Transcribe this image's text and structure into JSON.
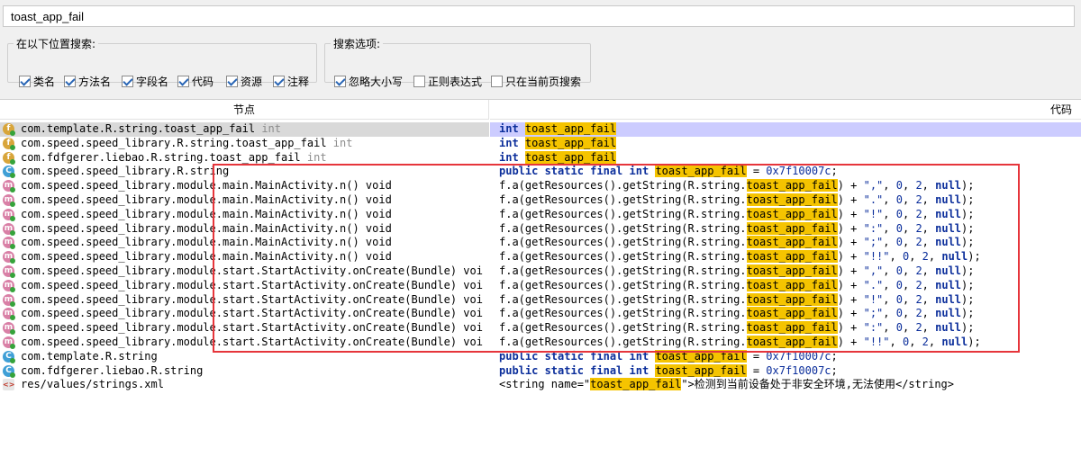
{
  "search": {
    "value": "toast_app_fail"
  },
  "search_in": {
    "legend": "在以下位置搜索:",
    "options": [
      {
        "label": "类名",
        "checked": true
      },
      {
        "label": "方法名",
        "checked": true
      },
      {
        "label": "字段名",
        "checked": true
      },
      {
        "label": "代码",
        "checked": true
      },
      {
        "label": "资源",
        "checked": true
      },
      {
        "label": "注释",
        "checked": true
      }
    ]
  },
  "search_options": {
    "legend": "搜索选项:",
    "options": [
      {
        "label": "忽略大小写",
        "checked": true
      },
      {
        "label": "正则表达式",
        "checked": false
      },
      {
        "label": "只在当前页搜索",
        "checked": false
      }
    ]
  },
  "columns": {
    "node": "节点",
    "code": "代码"
  },
  "colors": {
    "highlight": "#f5c400",
    "selected_row": "#ccccff",
    "red_box": "#e6353b",
    "keyword": "#0b2e9b"
  },
  "results": [
    {
      "icon": "field-icon",
      "node": "com.template.R.string.toast_app_fail",
      "sub": "int",
      "code": [
        [
          "kw",
          "int"
        ],
        [
          "t",
          " "
        ],
        [
          "hl",
          "toast_app_fail"
        ]
      ],
      "selected": true
    },
    {
      "icon": "field-icon",
      "node": "com.speed.speed_library.R.string.toast_app_fail",
      "sub": "int",
      "code": [
        [
          "kw",
          "int"
        ],
        [
          "t",
          " "
        ],
        [
          "hl",
          "toast_app_fail"
        ]
      ]
    },
    {
      "icon": "field-icon",
      "node": "com.fdfgerer.liebao.R.string.toast_app_fail",
      "sub": "int",
      "code": [
        [
          "kw",
          "int"
        ],
        [
          "t",
          " "
        ],
        [
          "hl",
          "toast_app_fail"
        ]
      ]
    },
    {
      "icon": "class-icon",
      "node": "com.speed.speed_library.R.string",
      "sub": "",
      "code": [
        [
          "kw",
          "public static final"
        ],
        [
          "t",
          " "
        ],
        [
          "kw",
          "int"
        ],
        [
          "t",
          " "
        ],
        [
          "hl",
          "toast_app_fail"
        ],
        [
          "t",
          " = "
        ],
        [
          "num",
          "0x7f10007c"
        ],
        [
          "t",
          ";"
        ]
      ]
    },
    {
      "icon": "method-icon",
      "node": "com.speed.speed_library.module.main.MainActivity.n() void",
      "sub": "",
      "code": [
        [
          "t",
          "f.a(getResources().getString(R.string."
        ],
        [
          "hl",
          "toast_app_fail"
        ],
        [
          "t",
          ") + "
        ],
        [
          "str",
          "\",\""
        ],
        [
          "t",
          ", "
        ],
        [
          "num",
          "0"
        ],
        [
          "t",
          ", "
        ],
        [
          "num",
          "2"
        ],
        [
          "t",
          ", "
        ],
        [
          "kw",
          "null"
        ],
        [
          "t",
          ");"
        ]
      ]
    },
    {
      "icon": "method-icon",
      "node": "com.speed.speed_library.module.main.MainActivity.n() void",
      "sub": "",
      "code": [
        [
          "t",
          "f.a(getResources().getString(R.string."
        ],
        [
          "hl",
          "toast_app_fail"
        ],
        [
          "t",
          ") + "
        ],
        [
          "str",
          "\".\""
        ],
        [
          "t",
          ", "
        ],
        [
          "num",
          "0"
        ],
        [
          "t",
          ", "
        ],
        [
          "num",
          "2"
        ],
        [
          "t",
          ", "
        ],
        [
          "kw",
          "null"
        ],
        [
          "t",
          ");"
        ]
      ]
    },
    {
      "icon": "method-icon",
      "node": "com.speed.speed_library.module.main.MainActivity.n() void",
      "sub": "",
      "code": [
        [
          "t",
          "f.a(getResources().getString(R.string."
        ],
        [
          "hl",
          "toast_app_fail"
        ],
        [
          "t",
          ") + "
        ],
        [
          "str",
          "\"!\""
        ],
        [
          "t",
          ", "
        ],
        [
          "num",
          "0"
        ],
        [
          "t",
          ", "
        ],
        [
          "num",
          "2"
        ],
        [
          "t",
          ", "
        ],
        [
          "kw",
          "null"
        ],
        [
          "t",
          ");"
        ]
      ]
    },
    {
      "icon": "method-icon",
      "node": "com.speed.speed_library.module.main.MainActivity.n() void",
      "sub": "",
      "code": [
        [
          "t",
          "f.a(getResources().getString(R.string."
        ],
        [
          "hl",
          "toast_app_fail"
        ],
        [
          "t",
          ") + "
        ],
        [
          "str",
          "\":\""
        ],
        [
          "t",
          ", "
        ],
        [
          "num",
          "0"
        ],
        [
          "t",
          ", "
        ],
        [
          "num",
          "2"
        ],
        [
          "t",
          ", "
        ],
        [
          "kw",
          "null"
        ],
        [
          "t",
          ");"
        ]
      ]
    },
    {
      "icon": "method-icon",
      "node": "com.speed.speed_library.module.main.MainActivity.n() void",
      "sub": "",
      "code": [
        [
          "t",
          "f.a(getResources().getString(R.string."
        ],
        [
          "hl",
          "toast_app_fail"
        ],
        [
          "t",
          ") + "
        ],
        [
          "str",
          "\";\""
        ],
        [
          "t",
          ", "
        ],
        [
          "num",
          "0"
        ],
        [
          "t",
          ", "
        ],
        [
          "num",
          "2"
        ],
        [
          "t",
          ", "
        ],
        [
          "kw",
          "null"
        ],
        [
          "t",
          ");"
        ]
      ]
    },
    {
      "icon": "method-icon",
      "node": "com.speed.speed_library.module.main.MainActivity.n() void",
      "sub": "",
      "code": [
        [
          "t",
          "f.a(getResources().getString(R.string."
        ],
        [
          "hl",
          "toast_app_fail"
        ],
        [
          "t",
          ") + "
        ],
        [
          "str",
          "\"!!\""
        ],
        [
          "t",
          ", "
        ],
        [
          "num",
          "0"
        ],
        [
          "t",
          ", "
        ],
        [
          "num",
          "2"
        ],
        [
          "t",
          ", "
        ],
        [
          "kw",
          "null"
        ],
        [
          "t",
          ");"
        ]
      ]
    },
    {
      "icon": "method-icon",
      "node": "com.speed.speed_library.module.start.StartActivity.onCreate(Bundle) voi",
      "sub": "",
      "code": [
        [
          "t",
          "f.a(getResources().getString(R.string."
        ],
        [
          "hl",
          "toast_app_fail"
        ],
        [
          "t",
          ") + "
        ],
        [
          "str",
          "\",\""
        ],
        [
          "t",
          ", "
        ],
        [
          "num",
          "0"
        ],
        [
          "t",
          ", "
        ],
        [
          "num",
          "2"
        ],
        [
          "t",
          ", "
        ],
        [
          "kw",
          "null"
        ],
        [
          "t",
          ");"
        ]
      ]
    },
    {
      "icon": "method-icon",
      "node": "com.speed.speed_library.module.start.StartActivity.onCreate(Bundle) voi",
      "sub": "",
      "code": [
        [
          "t",
          "f.a(getResources().getString(R.string."
        ],
        [
          "hl",
          "toast_app_fail"
        ],
        [
          "t",
          ") + "
        ],
        [
          "str",
          "\".\""
        ],
        [
          "t",
          ", "
        ],
        [
          "num",
          "0"
        ],
        [
          "t",
          ", "
        ],
        [
          "num",
          "2"
        ],
        [
          "t",
          ", "
        ],
        [
          "kw",
          "null"
        ],
        [
          "t",
          ");"
        ]
      ]
    },
    {
      "icon": "method-icon",
      "node": "com.speed.speed_library.module.start.StartActivity.onCreate(Bundle) voi",
      "sub": "",
      "code": [
        [
          "t",
          "f.a(getResources().getString(R.string."
        ],
        [
          "hl",
          "toast_app_fail"
        ],
        [
          "t",
          ") + "
        ],
        [
          "str",
          "\"!\""
        ],
        [
          "t",
          ", "
        ],
        [
          "num",
          "0"
        ],
        [
          "t",
          ", "
        ],
        [
          "num",
          "2"
        ],
        [
          "t",
          ", "
        ],
        [
          "kw",
          "null"
        ],
        [
          "t",
          ");"
        ]
      ]
    },
    {
      "icon": "method-icon",
      "node": "com.speed.speed_library.module.start.StartActivity.onCreate(Bundle) voi",
      "sub": "",
      "code": [
        [
          "t",
          "f.a(getResources().getString(R.string."
        ],
        [
          "hl",
          "toast_app_fail"
        ],
        [
          "t",
          ") + "
        ],
        [
          "str",
          "\";\""
        ],
        [
          "t",
          ", "
        ],
        [
          "num",
          "0"
        ],
        [
          "t",
          ", "
        ],
        [
          "num",
          "2"
        ],
        [
          "t",
          ", "
        ],
        [
          "kw",
          "null"
        ],
        [
          "t",
          ");"
        ]
      ]
    },
    {
      "icon": "method-icon",
      "node": "com.speed.speed_library.module.start.StartActivity.onCreate(Bundle) voi",
      "sub": "",
      "code": [
        [
          "t",
          "f.a(getResources().getString(R.string."
        ],
        [
          "hl",
          "toast_app_fail"
        ],
        [
          "t",
          ") + "
        ],
        [
          "str",
          "\":\""
        ],
        [
          "t",
          ", "
        ],
        [
          "num",
          "0"
        ],
        [
          "t",
          ", "
        ],
        [
          "num",
          "2"
        ],
        [
          "t",
          ", "
        ],
        [
          "kw",
          "null"
        ],
        [
          "t",
          ");"
        ]
      ]
    },
    {
      "icon": "method-icon",
      "node": "com.speed.speed_library.module.start.StartActivity.onCreate(Bundle) voi",
      "sub": "",
      "code": [
        [
          "t",
          "f.a(getResources().getString(R.string."
        ],
        [
          "hl",
          "toast_app_fail"
        ],
        [
          "t",
          ") + "
        ],
        [
          "str",
          "\"!!\""
        ],
        [
          "t",
          ", "
        ],
        [
          "num",
          "0"
        ],
        [
          "t",
          ", "
        ],
        [
          "num",
          "2"
        ],
        [
          "t",
          ", "
        ],
        [
          "kw",
          "null"
        ],
        [
          "t",
          ");"
        ]
      ]
    },
    {
      "icon": "class-icon",
      "node": "com.template.R.string",
      "sub": "",
      "code": [
        [
          "kw",
          "public static final"
        ],
        [
          "t",
          " "
        ],
        [
          "kw",
          "int"
        ],
        [
          "t",
          " "
        ],
        [
          "hl",
          "toast_app_fail"
        ],
        [
          "t",
          " = "
        ],
        [
          "num",
          "0x7f10007c"
        ],
        [
          "t",
          ";"
        ]
      ]
    },
    {
      "icon": "class-icon",
      "node": "com.fdfgerer.liebao.R.string",
      "sub": "",
      "code": [
        [
          "kw",
          "public static final"
        ],
        [
          "t",
          " "
        ],
        [
          "kw",
          "int"
        ],
        [
          "t",
          " "
        ],
        [
          "hl",
          "toast_app_fail"
        ],
        [
          "t",
          " = "
        ],
        [
          "num",
          "0x7f10007c"
        ],
        [
          "t",
          ";"
        ]
      ]
    },
    {
      "icon": "xml-icon",
      "node": "res/values/strings.xml",
      "sub": "",
      "code": [
        [
          "t",
          "<string name=\""
        ],
        [
          "hl",
          "toast_app_fail"
        ],
        [
          "t",
          "\">检测到当前设备处于非安全环境,无法使用</string>"
        ]
      ]
    }
  ]
}
